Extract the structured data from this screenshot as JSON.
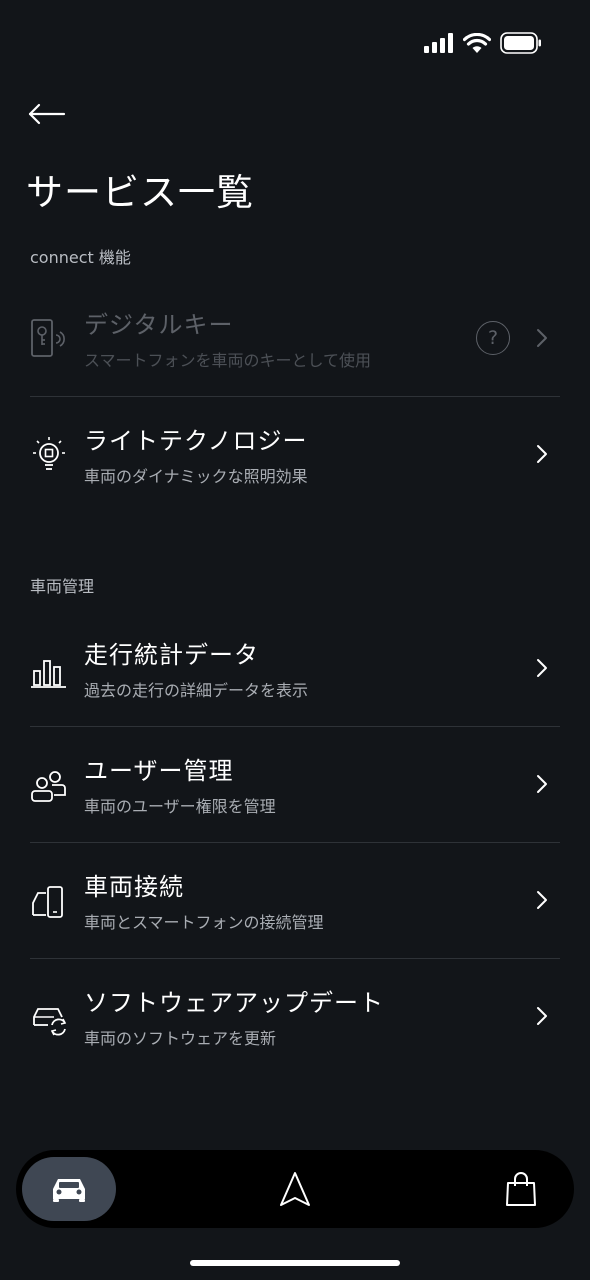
{
  "status_bar": {
    "signal_icon": "cellular-signal-icon",
    "wifi_icon": "wifi-icon",
    "battery_icon": "battery-icon"
  },
  "header": {
    "back_icon": "back-arrow-icon",
    "title": "サービス一覧"
  },
  "sections": [
    {
      "label": "connect 機能",
      "items": [
        {
          "title": "デジタルキー",
          "subtitle": "スマートフォンを車両のキーとして使用",
          "icon": "digital-key-icon",
          "disabled": true,
          "help": "?"
        },
        {
          "title": "ライトテクノロジー",
          "subtitle": "車両のダイナミックな照明効果",
          "icon": "light-bulb-icon",
          "disabled": false
        }
      ]
    },
    {
      "label": "車両管理",
      "items": [
        {
          "title": "走行統計データ",
          "subtitle": "過去の走行の詳細データを表示",
          "icon": "bar-chart-icon"
        },
        {
          "title": "ユーザー管理",
          "subtitle": "車両のユーザー権限を管理",
          "icon": "users-icon"
        },
        {
          "title": "車両接続",
          "subtitle": "車両とスマートフォンの接続管理",
          "icon": "car-phone-icon"
        },
        {
          "title": "ソフトウェアアップデート",
          "subtitle": "車両のソフトウェアを更新",
          "icon": "car-update-icon"
        }
      ]
    }
  ],
  "bottom_nav": [
    {
      "icon": "car-icon",
      "active": true
    },
    {
      "icon": "navigation-arrow-icon",
      "active": false
    },
    {
      "icon": "shopping-bag-icon",
      "active": false
    }
  ],
  "colors": {
    "background": "#121519",
    "nav_active": "#3f4753",
    "text_secondary": "#a9adb3",
    "disabled": "#5d6168"
  }
}
